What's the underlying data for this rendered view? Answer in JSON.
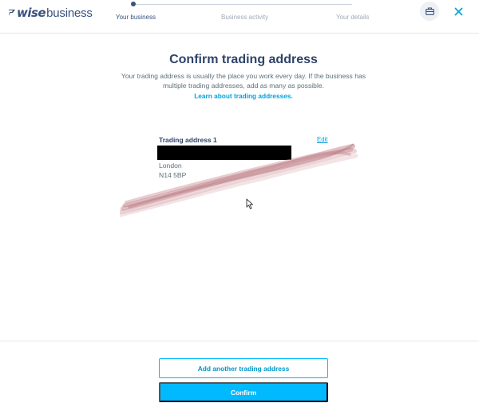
{
  "header": {
    "logo_brand": "wise",
    "logo_suffix": "business",
    "steps": [
      {
        "label": "Your business",
        "active": true
      },
      {
        "label": "Business activity",
        "active": false
      },
      {
        "label": "Your details",
        "active": false
      }
    ],
    "briefcase_icon": "briefcase-icon",
    "close_icon": "close-icon"
  },
  "main": {
    "title": "Confirm trading address",
    "description": "Your trading address is usually the place you work every day. If the business has multiple trading addresses, add as many as possible.",
    "learn_link": "Learn about trading addresses."
  },
  "address_card": {
    "title": "Trading address 1",
    "edit_label": "Edit",
    "city": "London",
    "postcode": "N14 5BP"
  },
  "footer": {
    "add_button": "Add another trading address",
    "confirm_button": "Confirm"
  },
  "colors": {
    "brand_navy": "#37517e",
    "accent_blue": "#00b9ff",
    "link_blue": "#00a2dd",
    "body_text": "#5d7079"
  }
}
